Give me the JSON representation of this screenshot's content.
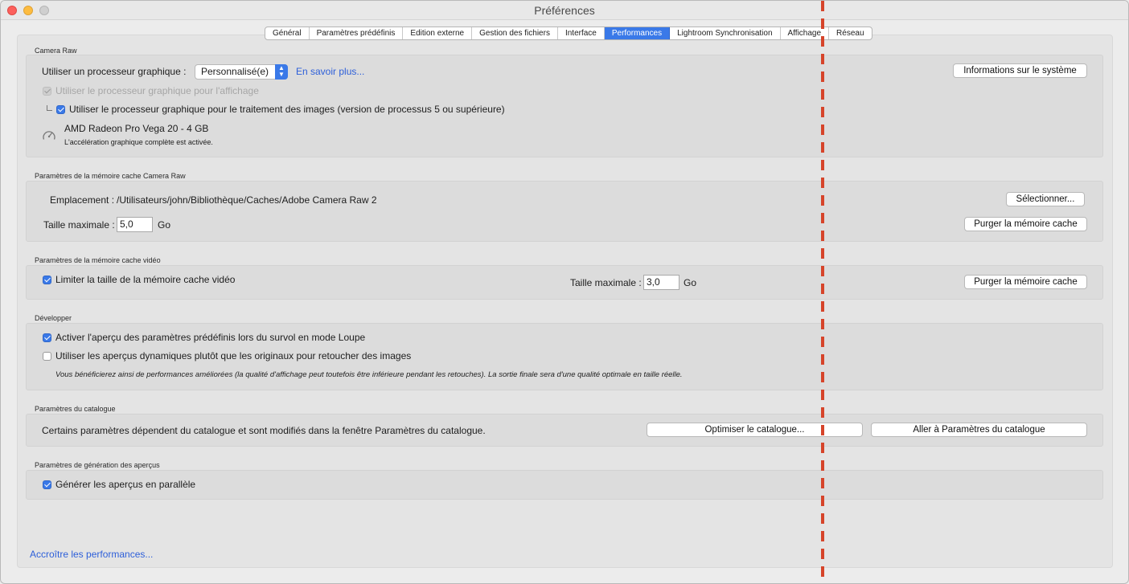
{
  "window": {
    "title": "Préférences"
  },
  "tabs": [
    {
      "label": "Général",
      "active": false
    },
    {
      "label": "Paramètres prédéfinis",
      "active": false
    },
    {
      "label": "Edition externe",
      "active": false
    },
    {
      "label": "Gestion des fichiers",
      "active": false
    },
    {
      "label": "Interface",
      "active": false
    },
    {
      "label": "Performances",
      "active": true
    },
    {
      "label": "Lightroom Synchronisation",
      "active": false
    },
    {
      "label": "Affichage",
      "active": false
    },
    {
      "label": "Réseau",
      "active": false
    }
  ],
  "camera_raw": {
    "title": "Camera Raw",
    "gpu_label": "Utiliser un processeur graphique :",
    "gpu_select": "Personnalisé(e)",
    "learn_more": "En savoir plus...",
    "system_info_button": "Informations sur le système",
    "gpu_display": {
      "label": "Utiliser le processeur graphique pour l'affichage",
      "checked": true,
      "disabled": true
    },
    "gpu_processing": {
      "label": "Utiliser le processeur graphique pour le traitement des images (version de processus 5 ou supérieure)",
      "checked": true
    },
    "gpu_name": "AMD Radeon Pro Vega 20 - 4 GB",
    "gpu_status": "L'accélération graphique complète est activée."
  },
  "cache": {
    "title": "Paramètres de la mémoire cache Camera Raw",
    "location_label": "Emplacement :",
    "location_path": "/Utilisateurs/john/Bibliothèque/Caches/Adobe Camera Raw 2",
    "select_button": "Sélectionner...",
    "max_label": "Taille maximale :",
    "max_value": "5,0",
    "unit": "Go",
    "purge_button": "Purger la mémoire cache"
  },
  "video_cache": {
    "title": "Paramètres de la mémoire cache vidéo",
    "limit": {
      "label": "Limiter la taille de la mémoire cache vidéo",
      "checked": true
    },
    "max_label": "Taille maximale :",
    "max_value": "3,0",
    "unit": "Go",
    "purge_button": "Purger la mémoire cache"
  },
  "develop": {
    "title": "Développer",
    "preset_preview": {
      "label": "Activer l'aperçu des paramètres prédéfinis lors du survol en mode Loupe",
      "checked": true
    },
    "smart_previews": {
      "label": "Utiliser les aperçus dynamiques plutôt que les originaux pour retoucher des images",
      "checked": false
    },
    "note": "Vous bénéficierez ainsi de performances améliorées (la qualité d'affichage peut toutefois être inférieure pendant les retouches). La sortie finale sera d'une qualité optimale en taille réelle."
  },
  "catalog": {
    "title": "Paramètres du catalogue",
    "description": "Certains paramètres dépendent du catalogue et sont modifiés dans la fenêtre Paramètres du catalogue.",
    "optimize_button": "Optimiser le catalogue...",
    "goto_button": "Aller à Paramètres du catalogue"
  },
  "previews": {
    "title": "Paramètres de génération des aperçus",
    "parallel": {
      "label": "Générer les aperçus en parallèle",
      "checked": true
    }
  },
  "footer": {
    "link": "Accroître les performances..."
  },
  "colors": {
    "accent": "#3a79e8",
    "link": "#2d5fd9",
    "annotation_line": "#d6442a"
  }
}
